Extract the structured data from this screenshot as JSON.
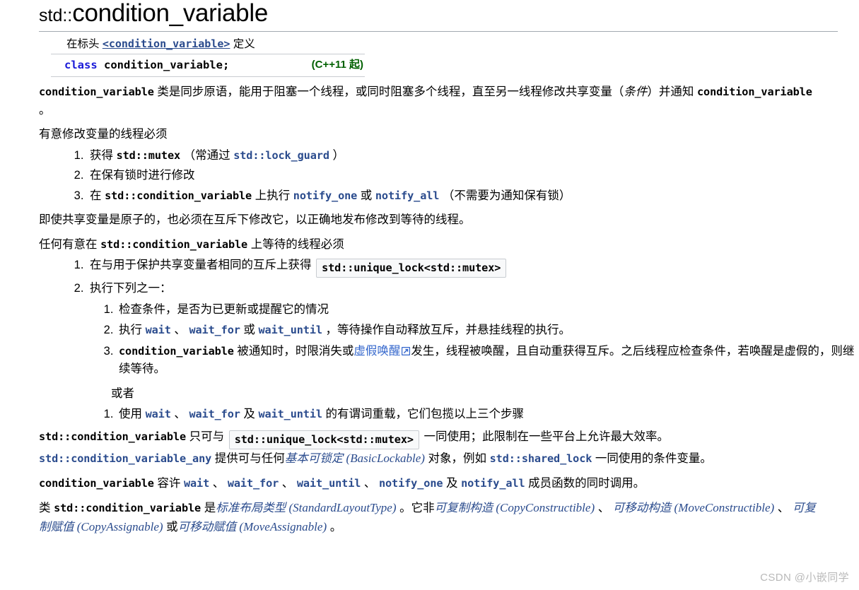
{
  "page": {
    "title_namespace": "std::",
    "title_name": "condition_variable"
  },
  "declaration": {
    "defined_in_prefix": "在标头 ",
    "header_link": "<condition_variable>",
    "defined_in_suffix": " 定义",
    "keyword": "class",
    "signature": " condition_variable;",
    "since": "(C++11 起)"
  },
  "intro": {
    "p1_code1": "condition_variable",
    "p1_t1": " 类是同步原语，能用于阻塞一个线程，或同时阻塞多个线程，直至另一线程修改共享变量（",
    "p1_em": "条件",
    "p1_t2": "）并通知 ",
    "p1_code2": "condition_variable",
    "p1_t3": " 。",
    "p2": "有意修改变量的线程必须"
  },
  "list_modify": {
    "i1_t1": "获得 ",
    "i1_code": "std::mutex",
    "i1_t2": " （常通过 ",
    "i1_link": "std::lock_guard",
    "i1_t3": " ）",
    "i2": "在保有锁时进行修改",
    "i3_t1": "在 ",
    "i3_code": "std::condition_variable",
    "i3_t2": " 上执行 ",
    "i3_link1": "notify_one",
    "i3_t3": " 或 ",
    "i3_link2": "notify_all",
    "i3_t4": " （不需要为通知保有锁）"
  },
  "mid": {
    "p_atomic": "即使共享变量是原子的，也必须在互斥下修改它，以正确地发布修改到等待的线程。",
    "p_wait_t1": "任何有意在 ",
    "p_wait_code": "std::condition_variable",
    "p_wait_t2": " 上等待的线程必须"
  },
  "list_wait": {
    "i1_t1": "在与用于保护共享变量者相同的互斥上获得 ",
    "i1_code": "std::unique_lock<std::mutex>",
    "i2": "执行下列之一：",
    "sub": {
      "s1": "检查条件，是否为已更新或提醒它的情况",
      "s2_t1": "执行 ",
      "s2_l1": "wait",
      "s2_t2": " 、 ",
      "s2_l2": "wait_for",
      "s2_t3": " 或 ",
      "s2_l3": "wait_until",
      "s2_t4": " ，等待操作自动释放互斥，并悬挂线程的执行。",
      "s3_code": "condition_variable",
      "s3_t1": " 被通知时，时限消失或",
      "s3_link": "虚假唤醒",
      "s3_t2": "发生，线程被唤醒，且自动重获得互斥。之后线程应检查条件，若唤醒是虚假的，则继续等待。"
    },
    "or_label": "或者",
    "alt": {
      "t1": "使用 ",
      "l1": "wait",
      "t2": " 、 ",
      "l2": "wait_for",
      "t3": " 及 ",
      "l3": "wait_until",
      "t4": " 的有谓词重载，它们包揽以上三个步骤"
    }
  },
  "closing": {
    "p1_code": "std::condition_variable",
    "p1_t1": " 只可与 ",
    "p1_box": "std::unique_lock<std::mutex>",
    "p1_t2": " 一同使用；此限制在一些平台上允许最大效率。",
    "p1_link2": "std::condition_variable_any",
    "p1_t3": " 提供可与任何",
    "p1_ilink_cn": "基本可锁定",
    "p1_ilink_en": " (BasicLockable)",
    "p1_t4": " 对象，例如 ",
    "p1_link3": "std::shared_lock",
    "p1_t5": " 一同使用的条件变量。",
    "p2_code": "condition_variable",
    "p2_t1": " 容许 ",
    "p2_l1": "wait",
    "p2_t2": " 、 ",
    "p2_l2": "wait_for",
    "p2_t3": " 、 ",
    "p2_l3": "wait_until",
    "p2_t4": " 、 ",
    "p2_l4": "notify_one",
    "p2_t5": " 及 ",
    "p2_l5": "notify_all",
    "p2_t6": " 成员函数的同时调用。",
    "p3_t0": "类 ",
    "p3_code": "std::condition_variable",
    "p3_t1": " 是",
    "p3_i1_cn": "标准布局类型",
    "p3_i1_en": " (StandardLayoutType)",
    "p3_t2": " 。它非",
    "p3_i2_cn": "可复制构造",
    "p3_i2_en": " (CopyConstructible)",
    "p3_t3": " 、 ",
    "p3_i3_cn": "可移动构造",
    "p3_i3_en": " (MoveConstructible)",
    "p3_t4": " 、 ",
    "p3_i4_cn": "可复制赋值",
    "p3_i4_en": " (CopyAssignable)",
    "p3_t5": " 或",
    "p3_i5_cn": "可移动赋值",
    "p3_i5_en": " (MoveAssignable)",
    "p3_t6": " 。"
  },
  "watermark": "CSDN @小嵌同学",
  "colors": {
    "link": "#2a4b8d",
    "keyword": "#1a1ad8",
    "since": "#006000",
    "italic_link": "#2a4b8d",
    "watermark": "#b9b9b9",
    "rule": "#a2a9b1",
    "codebox_bg": "#f8f9fa",
    "codebox_border": "#c8ccd1"
  }
}
